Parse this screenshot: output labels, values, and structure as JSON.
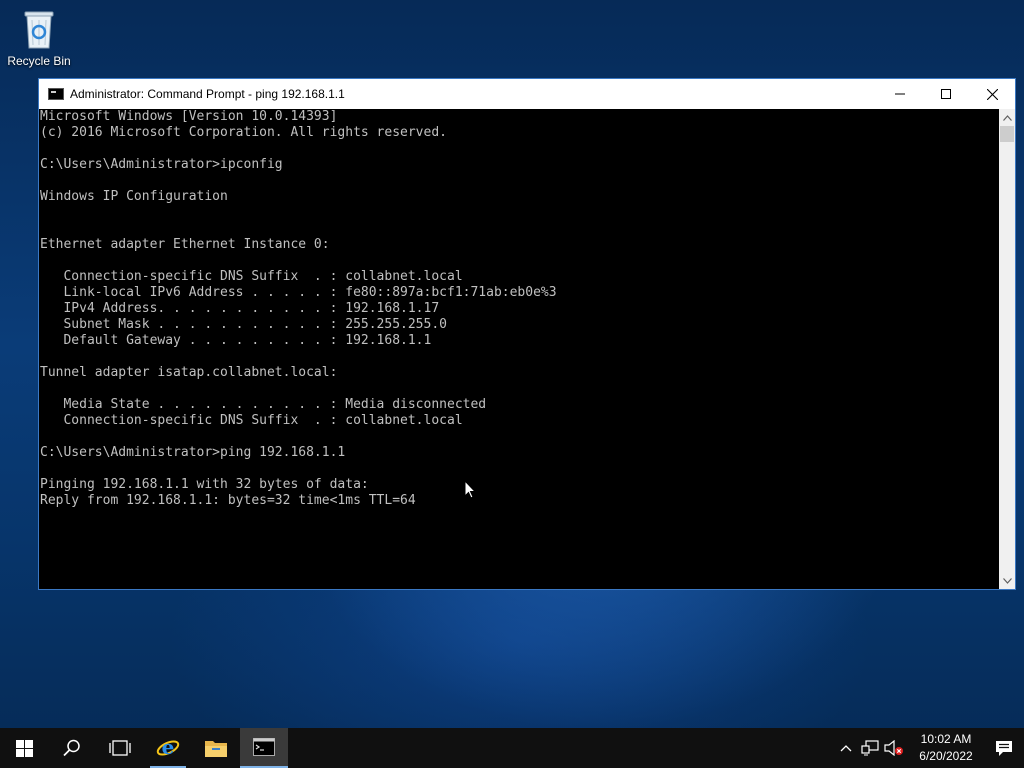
{
  "desktop": {
    "icons": [
      {
        "label": "Recycle Bin",
        "icon": "recycle-bin-icon"
      }
    ]
  },
  "window": {
    "title": "Administrator: Command Prompt - ping  192.168.1.1",
    "icon": "command-prompt-icon",
    "controls": {
      "minimize": "—",
      "maximize": "☐",
      "close": "✕"
    },
    "console_lines": [
      "Microsoft Windows [Version 10.0.14393]",
      "(c) 2016 Microsoft Corporation. All rights reserved.",
      "",
      "C:\\Users\\Administrator>ipconfig",
      "",
      "Windows IP Configuration",
      "",
      "",
      "Ethernet adapter Ethernet Instance 0:",
      "",
      "   Connection-specific DNS Suffix  . : collabnet.local",
      "   Link-local IPv6 Address . . . . . : fe80::897a:bcf1:71ab:eb0e%3",
      "   IPv4 Address. . . . . . . . . . . : 192.168.1.17",
      "   Subnet Mask . . . . . . . . . . . : 255.255.255.0",
      "   Default Gateway . . . . . . . . . : 192.168.1.1",
      "",
      "Tunnel adapter isatap.collabnet.local:",
      "",
      "   Media State . . . . . . . . . . . : Media disconnected",
      "   Connection-specific DNS Suffix  . : collabnet.local",
      "",
      "C:\\Users\\Administrator>ping 192.168.1.1",
      "",
      "Pinging 192.168.1.1 with 32 bytes of data:",
      "Reply from 192.168.1.1: bytes=32 time<1ms TTL=64"
    ]
  },
  "taskbar": {
    "buttons": [
      {
        "name": "start-button",
        "icon": "windows-logo-icon"
      },
      {
        "name": "search-button",
        "icon": "search-icon"
      },
      {
        "name": "task-view-button",
        "icon": "task-view-icon"
      },
      {
        "name": "internet-explorer-button",
        "icon": "internet-explorer-icon"
      },
      {
        "name": "file-explorer-button",
        "icon": "folder-icon"
      },
      {
        "name": "command-prompt-button",
        "icon": "command-prompt-icon"
      }
    ],
    "tray": {
      "time": "10:02 AM",
      "date": "6/20/2022",
      "icons": [
        "chevron-up-icon",
        "network-icon",
        "volume-muted-icon"
      ],
      "notification_icon": "action-center-icon"
    }
  },
  "colors": {
    "console_bg": "#000000",
    "console_text": "#c0c0c0",
    "taskbar_bg": "#101010",
    "active_accent": "#7fb3e8",
    "window_border": "#3a78c4"
  }
}
